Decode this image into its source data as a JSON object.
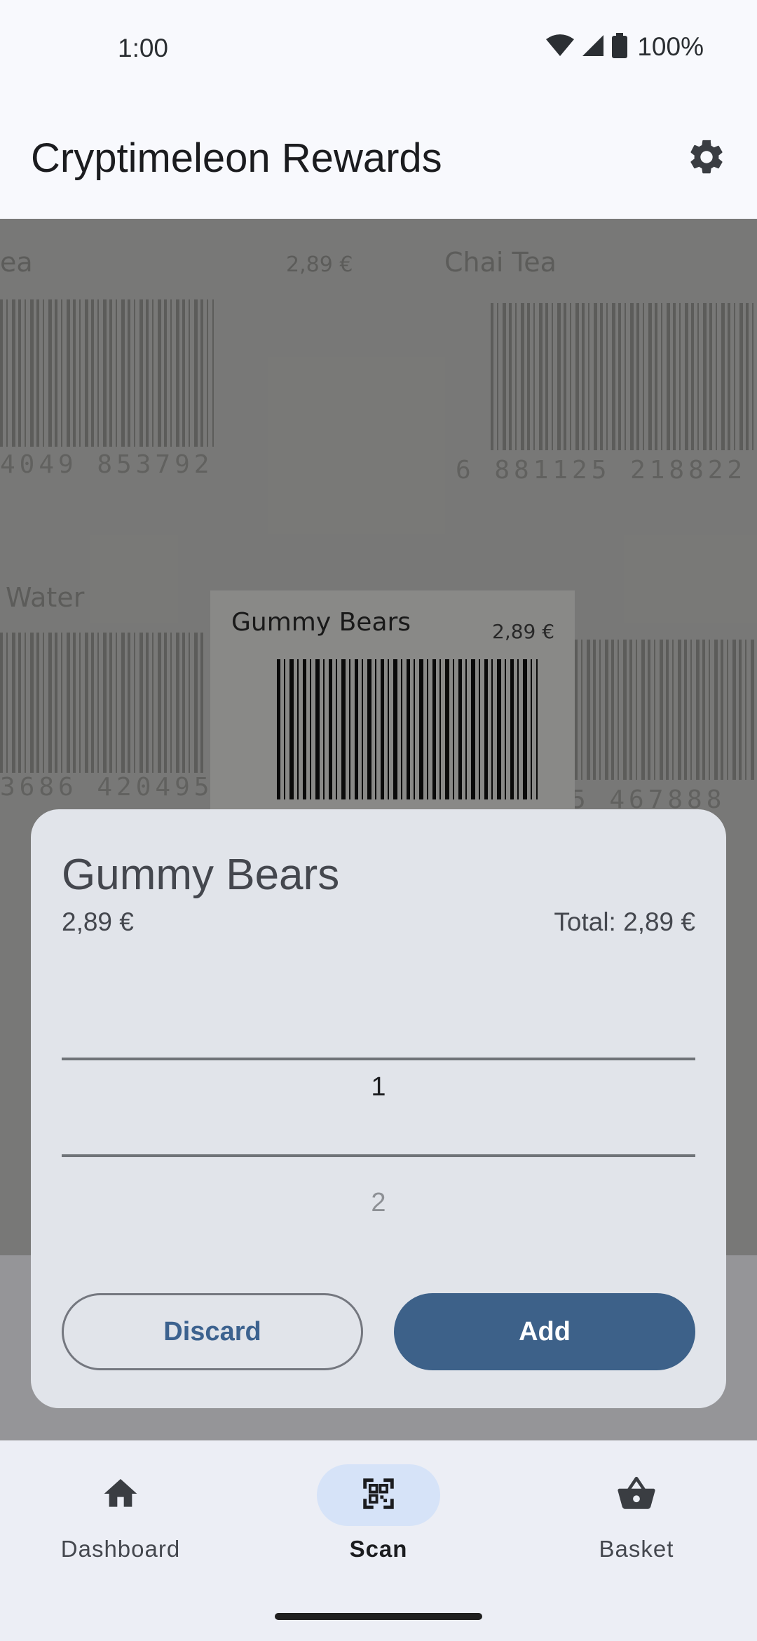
{
  "status": {
    "time": "1:00",
    "battery": "100%"
  },
  "app_bar": {
    "title": "Cryptimeleon Rewards",
    "settings_icon": "gear-icon"
  },
  "camera": {
    "products": [
      {
        "label": "ea",
        "price": "2,89 €",
        "digits": "4049   853792"
      },
      {
        "label": "Chai Tea",
        "digits": "6   881125   218822"
      },
      {
        "label": "Water",
        "digits": "3686   420495"
      },
      {
        "label": "",
        "digits": "5   467888"
      }
    ],
    "focused": {
      "label": "Gummy Bears",
      "price": "2,89 €"
    }
  },
  "dialog": {
    "title": "Gummy Bears",
    "price": "2,89 €",
    "total": "Total: 2,89 €",
    "quantity_selected": "1",
    "quantity_next": "2",
    "discard_label": "Discard",
    "add_label": "Add"
  },
  "nav": {
    "items": [
      {
        "label": "Dashboard",
        "icon": "home-icon",
        "active": false
      },
      {
        "label": "Scan",
        "icon": "qr-code-scanner-icon",
        "active": true
      },
      {
        "label": "Basket",
        "icon": "basket-icon",
        "active": false
      }
    ]
  },
  "colors": {
    "primary": "#3d6189",
    "nav_active_pill": "#d6e3f8",
    "dialog_bg": "#e1e4ea"
  }
}
